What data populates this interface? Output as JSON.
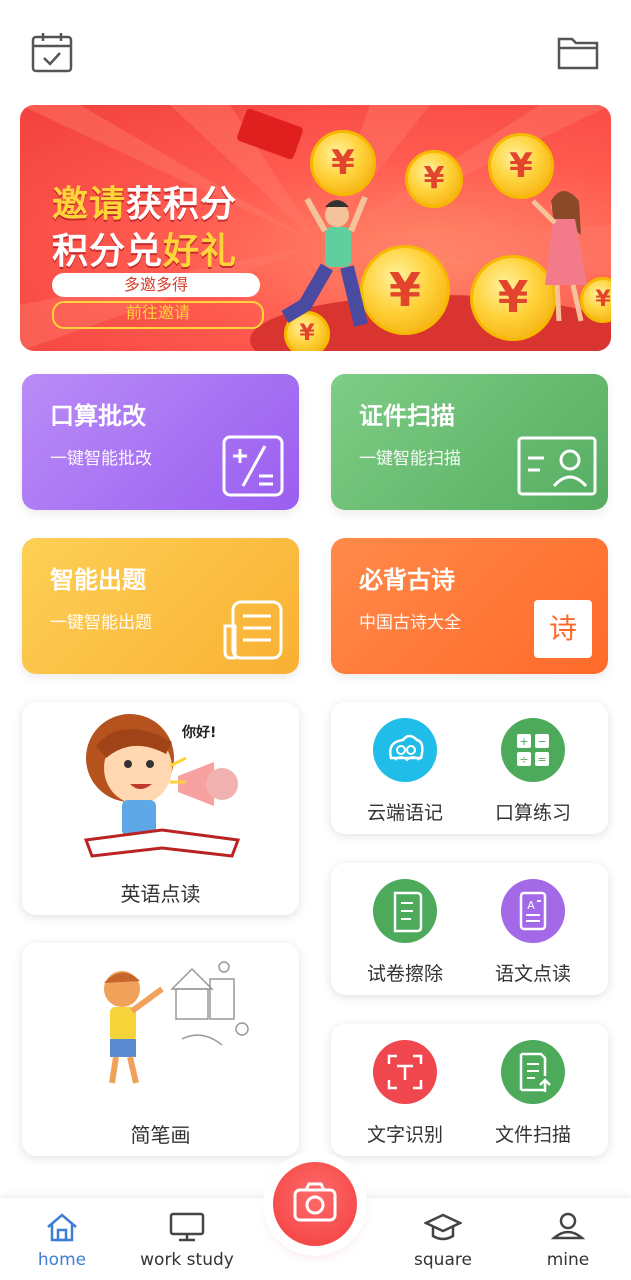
{
  "banner": {
    "line1_hl": "邀请",
    "line1_rest": "获积分",
    "line2_rest": "积分兑",
    "line2_hl": "好礼",
    "pill1": "多邀多得",
    "pill2": "前往邀请",
    "coin_symbol": "¥"
  },
  "features": [
    {
      "title": "口算批改",
      "subtitle": "一键智能批改",
      "icon": "math-correction-icon",
      "color": "#a06af0"
    },
    {
      "title": "证件扫描",
      "subtitle": "一键智能扫描",
      "icon": "id-card-icon",
      "color": "#5fb86a"
    },
    {
      "title": "智能出题",
      "subtitle": "一键智能出题",
      "icon": "paper-stack-icon",
      "color": "#fbb93a"
    },
    {
      "title": "必背古诗",
      "subtitle": "中国古诗大全",
      "icon": "poem-book-icon",
      "color": "#ff7733"
    }
  ],
  "poem_char": "诗",
  "english": {
    "label": "英语点读",
    "speech": "你好!"
  },
  "drawing": {
    "label": "简笔画"
  },
  "tools": [
    {
      "label": "云端语记",
      "icon": "cloud-voice-icon",
      "color": "#1fbde8"
    },
    {
      "label": "口算练习",
      "icon": "calculator-icon",
      "color": "#4caa5a"
    },
    {
      "label": "试卷擦除",
      "icon": "scroll-icon",
      "color": "#4caa5a"
    },
    {
      "label": "语文点读",
      "icon": "text-book-icon",
      "color": "#a369e6"
    },
    {
      "label": "文字识别",
      "icon": "text-scan-icon",
      "color": "#f0474e"
    },
    {
      "label": "文件扫描",
      "icon": "file-scan-icon",
      "color": "#4caa5a"
    }
  ],
  "nav": {
    "home": "home",
    "work": "work study",
    "square": "square",
    "mine": "mine"
  },
  "colors": {
    "accent": "#3d7dd6",
    "camera": "#f23d3d"
  }
}
